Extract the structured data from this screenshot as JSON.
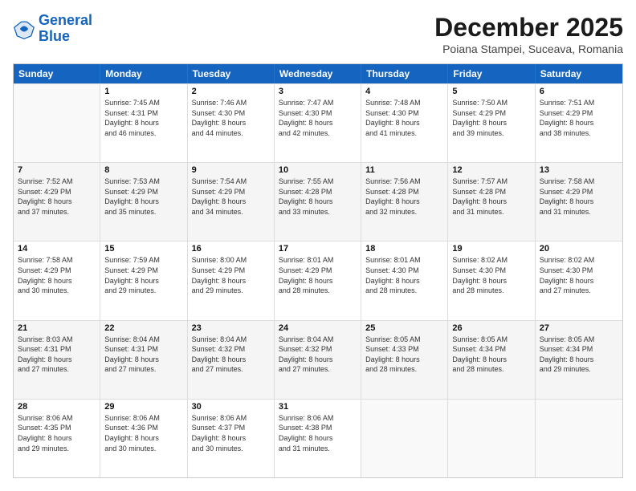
{
  "logo": {
    "line1": "General",
    "line2": "Blue"
  },
  "title": "December 2025",
  "subtitle": "Poiana Stampei, Suceava, Romania",
  "days": [
    "Sunday",
    "Monday",
    "Tuesday",
    "Wednesday",
    "Thursday",
    "Friday",
    "Saturday"
  ],
  "rows": [
    [
      {
        "num": "",
        "lines": []
      },
      {
        "num": "1",
        "lines": [
          "Sunrise: 7:45 AM",
          "Sunset: 4:31 PM",
          "Daylight: 8 hours",
          "and 46 minutes."
        ]
      },
      {
        "num": "2",
        "lines": [
          "Sunrise: 7:46 AM",
          "Sunset: 4:30 PM",
          "Daylight: 8 hours",
          "and 44 minutes."
        ]
      },
      {
        "num": "3",
        "lines": [
          "Sunrise: 7:47 AM",
          "Sunset: 4:30 PM",
          "Daylight: 8 hours",
          "and 42 minutes."
        ]
      },
      {
        "num": "4",
        "lines": [
          "Sunrise: 7:48 AM",
          "Sunset: 4:30 PM",
          "Daylight: 8 hours",
          "and 41 minutes."
        ]
      },
      {
        "num": "5",
        "lines": [
          "Sunrise: 7:50 AM",
          "Sunset: 4:29 PM",
          "Daylight: 8 hours",
          "and 39 minutes."
        ]
      },
      {
        "num": "6",
        "lines": [
          "Sunrise: 7:51 AM",
          "Sunset: 4:29 PM",
          "Daylight: 8 hours",
          "and 38 minutes."
        ]
      }
    ],
    [
      {
        "num": "7",
        "lines": [
          "Sunrise: 7:52 AM",
          "Sunset: 4:29 PM",
          "Daylight: 8 hours",
          "and 37 minutes."
        ]
      },
      {
        "num": "8",
        "lines": [
          "Sunrise: 7:53 AM",
          "Sunset: 4:29 PM",
          "Daylight: 8 hours",
          "and 35 minutes."
        ]
      },
      {
        "num": "9",
        "lines": [
          "Sunrise: 7:54 AM",
          "Sunset: 4:29 PM",
          "Daylight: 8 hours",
          "and 34 minutes."
        ]
      },
      {
        "num": "10",
        "lines": [
          "Sunrise: 7:55 AM",
          "Sunset: 4:28 PM",
          "Daylight: 8 hours",
          "and 33 minutes."
        ]
      },
      {
        "num": "11",
        "lines": [
          "Sunrise: 7:56 AM",
          "Sunset: 4:28 PM",
          "Daylight: 8 hours",
          "and 32 minutes."
        ]
      },
      {
        "num": "12",
        "lines": [
          "Sunrise: 7:57 AM",
          "Sunset: 4:28 PM",
          "Daylight: 8 hours",
          "and 31 minutes."
        ]
      },
      {
        "num": "13",
        "lines": [
          "Sunrise: 7:58 AM",
          "Sunset: 4:29 PM",
          "Daylight: 8 hours",
          "and 31 minutes."
        ]
      }
    ],
    [
      {
        "num": "14",
        "lines": [
          "Sunrise: 7:58 AM",
          "Sunset: 4:29 PM",
          "Daylight: 8 hours",
          "and 30 minutes."
        ]
      },
      {
        "num": "15",
        "lines": [
          "Sunrise: 7:59 AM",
          "Sunset: 4:29 PM",
          "Daylight: 8 hours",
          "and 29 minutes."
        ]
      },
      {
        "num": "16",
        "lines": [
          "Sunrise: 8:00 AM",
          "Sunset: 4:29 PM",
          "Daylight: 8 hours",
          "and 29 minutes."
        ]
      },
      {
        "num": "17",
        "lines": [
          "Sunrise: 8:01 AM",
          "Sunset: 4:29 PM",
          "Daylight: 8 hours",
          "and 28 minutes."
        ]
      },
      {
        "num": "18",
        "lines": [
          "Sunrise: 8:01 AM",
          "Sunset: 4:30 PM",
          "Daylight: 8 hours",
          "and 28 minutes."
        ]
      },
      {
        "num": "19",
        "lines": [
          "Sunrise: 8:02 AM",
          "Sunset: 4:30 PM",
          "Daylight: 8 hours",
          "and 28 minutes."
        ]
      },
      {
        "num": "20",
        "lines": [
          "Sunrise: 8:02 AM",
          "Sunset: 4:30 PM",
          "Daylight: 8 hours",
          "and 27 minutes."
        ]
      }
    ],
    [
      {
        "num": "21",
        "lines": [
          "Sunrise: 8:03 AM",
          "Sunset: 4:31 PM",
          "Daylight: 8 hours",
          "and 27 minutes."
        ]
      },
      {
        "num": "22",
        "lines": [
          "Sunrise: 8:04 AM",
          "Sunset: 4:31 PM",
          "Daylight: 8 hours",
          "and 27 minutes."
        ]
      },
      {
        "num": "23",
        "lines": [
          "Sunrise: 8:04 AM",
          "Sunset: 4:32 PM",
          "Daylight: 8 hours",
          "and 27 minutes."
        ]
      },
      {
        "num": "24",
        "lines": [
          "Sunrise: 8:04 AM",
          "Sunset: 4:32 PM",
          "Daylight: 8 hours",
          "and 27 minutes."
        ]
      },
      {
        "num": "25",
        "lines": [
          "Sunrise: 8:05 AM",
          "Sunset: 4:33 PM",
          "Daylight: 8 hours",
          "and 28 minutes."
        ]
      },
      {
        "num": "26",
        "lines": [
          "Sunrise: 8:05 AM",
          "Sunset: 4:34 PM",
          "Daylight: 8 hours",
          "and 28 minutes."
        ]
      },
      {
        "num": "27",
        "lines": [
          "Sunrise: 8:05 AM",
          "Sunset: 4:34 PM",
          "Daylight: 8 hours",
          "and 29 minutes."
        ]
      }
    ],
    [
      {
        "num": "28",
        "lines": [
          "Sunrise: 8:06 AM",
          "Sunset: 4:35 PM",
          "Daylight: 8 hours",
          "and 29 minutes."
        ]
      },
      {
        "num": "29",
        "lines": [
          "Sunrise: 8:06 AM",
          "Sunset: 4:36 PM",
          "Daylight: 8 hours",
          "and 30 minutes."
        ]
      },
      {
        "num": "30",
        "lines": [
          "Sunrise: 8:06 AM",
          "Sunset: 4:37 PM",
          "Daylight: 8 hours",
          "and 30 minutes."
        ]
      },
      {
        "num": "31",
        "lines": [
          "Sunrise: 8:06 AM",
          "Sunset: 4:38 PM",
          "Daylight: 8 hours",
          "and 31 minutes."
        ]
      },
      {
        "num": "",
        "lines": []
      },
      {
        "num": "",
        "lines": []
      },
      {
        "num": "",
        "lines": []
      }
    ]
  ]
}
